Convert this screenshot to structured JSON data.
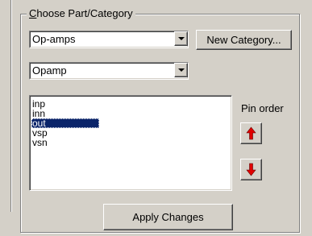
{
  "groupbox": {
    "title_first": "C",
    "title_rest": "hoose Part/Category"
  },
  "category_combo": {
    "value": "Op-amps",
    "arrow_icon": "chevron-down-icon"
  },
  "new_category_button": {
    "label": "New Category..."
  },
  "part_combo": {
    "value": "Opamp",
    "arrow_icon": "chevron-down-icon"
  },
  "pins": {
    "items": [
      "inp",
      "inn",
      "out",
      "vsp",
      "vsn"
    ],
    "selected": "out"
  },
  "pin_order": {
    "label": "Pin order",
    "up_icon": "arrow-up-icon",
    "down_icon": "arrow-down-icon",
    "arrow_color": "#e00000"
  },
  "apply_button": {
    "label": "Apply Changes"
  },
  "colors": {
    "face": "#d4d0c8",
    "selection": "#0a246a"
  }
}
